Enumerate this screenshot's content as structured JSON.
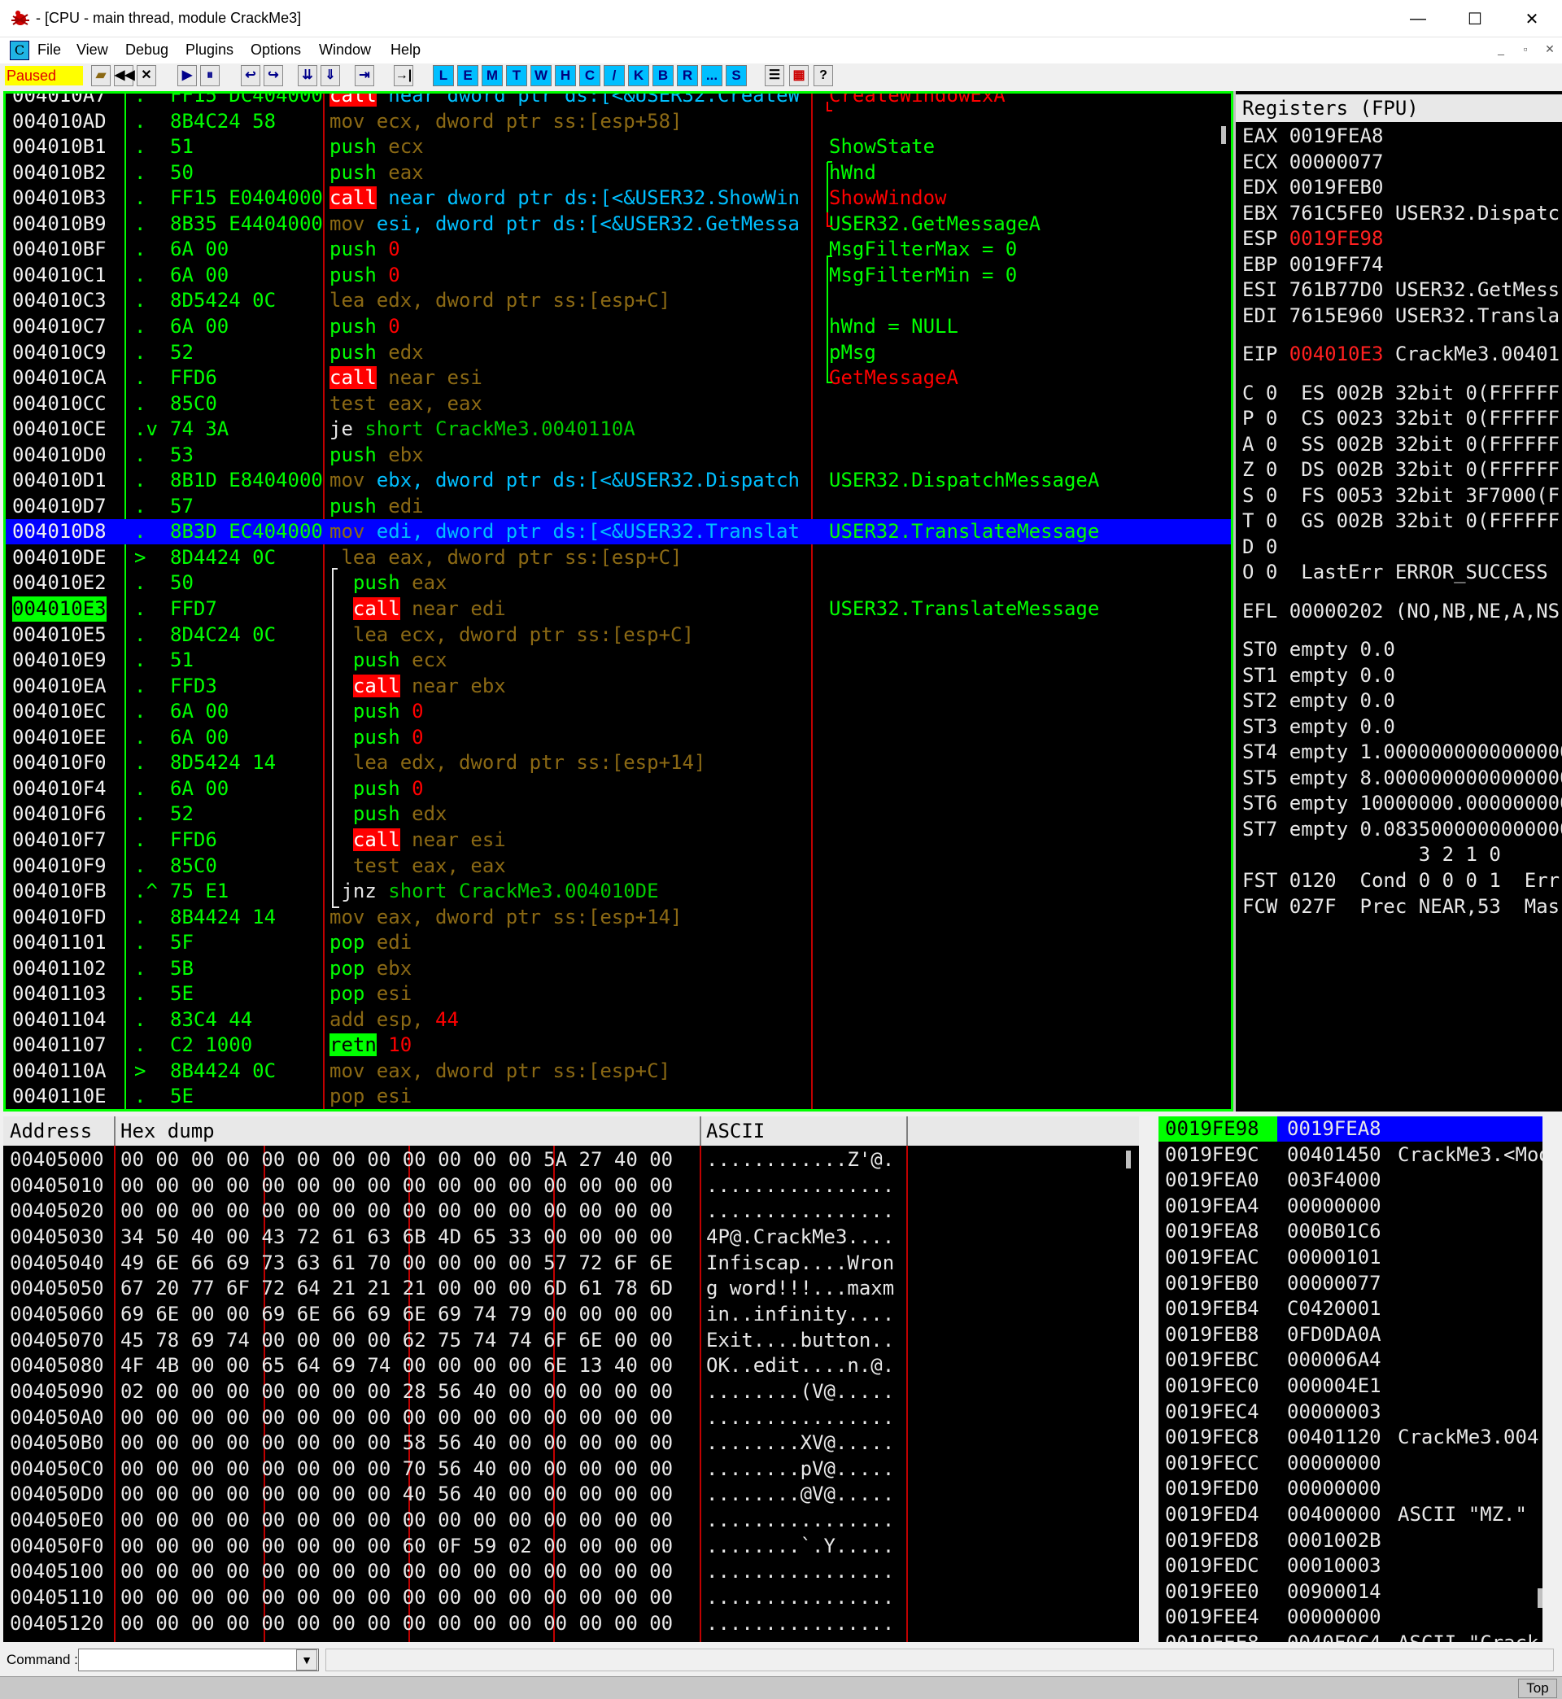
{
  "window": {
    "title": "- [CPU - main thread, module CrackMe3]",
    "minimize": "—",
    "maximize": "☐",
    "close": "✕"
  },
  "menu": {
    "cpu_icon": "C",
    "items": [
      "File",
      "View",
      "Debug",
      "Plugins",
      "Options",
      "Window",
      "Help"
    ],
    "mdi": [
      "_",
      "▫",
      "✕"
    ]
  },
  "toolbar": {
    "status": "Paused",
    "buttons": [
      "▶",
      "⏸",
      "↩",
      "↪",
      "⇊",
      "⇓",
      "⇥",
      "→|"
    ],
    "letters": [
      "L",
      "E",
      "M",
      "T",
      "W",
      "H",
      "C",
      "/",
      "K",
      "B",
      "R",
      "...",
      "S"
    ],
    "tail": [
      "☰",
      "▦",
      "?"
    ]
  },
  "disasm": {
    "rows": [
      {
        "addr": "004010A7",
        "mark": ".",
        "hex": "FF15 DC404000",
        "parts": [
          [
            "call",
            "call"
          ],
          [
            " near dword ptr ds:[<&USER32.CreateW",
            "cyan"
          ]
        ],
        "comment": "CreateWindowExA",
        "ccls": "red"
      },
      {
        "addr": "004010AD",
        "mark": ".",
        "hex": "8B4C24 58",
        "parts": [
          [
            "mov ecx, dword ptr ss:[esp+58]",
            "dim"
          ]
        ],
        "comment": ""
      },
      {
        "addr": "004010B1",
        "mark": ".",
        "hex": "51",
        "parts": [
          [
            "push ",
            "push"
          ],
          [
            "ecx",
            "dim"
          ]
        ],
        "comment": "ShowState"
      },
      {
        "addr": "004010B2",
        "mark": ".",
        "hex": "50",
        "parts": [
          [
            "push ",
            "push"
          ],
          [
            "eax",
            "dim"
          ]
        ],
        "comment": "hWnd"
      },
      {
        "addr": "004010B3",
        "mark": ".",
        "hex": "FF15 E0404000",
        "parts": [
          [
            "call",
            "call"
          ],
          [
            " near dword ptr ds:[<&USER32.ShowWin",
            "cyan"
          ]
        ],
        "comment": "ShowWindow",
        "ccls": "red"
      },
      {
        "addr": "004010B9",
        "mark": ".",
        "hex": "8B35 E4404000",
        "parts": [
          [
            "mov ",
            "dim"
          ],
          [
            "esi, dword ptr ds:[<&USER32.GetMessa",
            "cyan"
          ]
        ],
        "comment": "USER32.GetMessageA"
      },
      {
        "addr": "004010BF",
        "mark": ".",
        "hex": "6A 00",
        "parts": [
          [
            "push ",
            "push"
          ],
          [
            "0",
            "red"
          ]
        ],
        "comment": "MsgFilterMax = 0"
      },
      {
        "addr": "004010C1",
        "mark": ".",
        "hex": "6A 00",
        "parts": [
          [
            "push ",
            "push"
          ],
          [
            "0",
            "red"
          ]
        ],
        "comment": "MsgFilterMin = 0"
      },
      {
        "addr": "004010C3",
        "mark": ".",
        "hex": "8D5424 0C",
        "parts": [
          [
            "lea edx, dword ptr ss:[esp+C]",
            "dim"
          ]
        ],
        "comment": ""
      },
      {
        "addr": "004010C7",
        "mark": ".",
        "hex": "6A 00",
        "parts": [
          [
            "push ",
            "push"
          ],
          [
            "0",
            "red"
          ]
        ],
        "comment": "hWnd = NULL"
      },
      {
        "addr": "004010C9",
        "mark": ".",
        "hex": "52",
        "parts": [
          [
            "push ",
            "push"
          ],
          [
            "edx",
            "dim"
          ]
        ],
        "comment": "pMsg"
      },
      {
        "addr": "004010CA",
        "mark": ".",
        "hex": "FFD6",
        "parts": [
          [
            "call",
            "call"
          ],
          [
            " near esi",
            "dim"
          ]
        ],
        "comment": "GetMessageA",
        "ccls": "red"
      },
      {
        "addr": "004010CC",
        "mark": ".",
        "hex": "85C0",
        "parts": [
          [
            "test eax, eax",
            "dim"
          ]
        ],
        "comment": ""
      },
      {
        "addr": "004010CE",
        "mark": ".v",
        "hex": "74 3A",
        "parts": [
          [
            "je ",
            "white"
          ],
          [
            "short CrackMe3.0040110A",
            "green"
          ]
        ],
        "comment": ""
      },
      {
        "addr": "004010D0",
        "mark": ".",
        "hex": "53",
        "parts": [
          [
            "push ",
            "push"
          ],
          [
            "ebx",
            "dim"
          ]
        ],
        "comment": ""
      },
      {
        "addr": "004010D1",
        "mark": ".",
        "hex": "8B1D E8404000",
        "parts": [
          [
            "mov ",
            "dim"
          ],
          [
            "ebx, dword ptr ds:[<&USER32.Dispatch",
            "cyan"
          ]
        ],
        "comment": "USER32.DispatchMessageA"
      },
      {
        "addr": "004010D7",
        "mark": ".",
        "hex": "57",
        "parts": [
          [
            "push ",
            "push"
          ],
          [
            "edi",
            "dim"
          ]
        ],
        "comment": ""
      },
      {
        "addr": "004010D8",
        "mark": ".",
        "hex": "8B3D EC404000",
        "parts": [
          [
            "mov ",
            "dim"
          ],
          [
            "edi, dword ptr ds:[<&USER32.Translat",
            "cyan"
          ]
        ],
        "comment": "USER32.TranslateMessage",
        "sel": true
      },
      {
        "addr": "004010DE",
        "mark": ">",
        "hex": "8D4424 0C",
        "parts": [
          [
            " lea eax, dword ptr ss:[esp+C]",
            "dim"
          ]
        ],
        "comment": ""
      },
      {
        "addr": "004010E2",
        "mark": ".",
        "hex": "50",
        "parts": [
          [
            "  push ",
            "push"
          ],
          [
            "eax",
            "dim"
          ]
        ],
        "comment": ""
      },
      {
        "addr": "004010E3",
        "mark": ".",
        "hex": "FFD7",
        "parts": [
          [
            "  ",
            ""
          ],
          [
            "call",
            "call"
          ],
          [
            " near edi",
            "dim"
          ]
        ],
        "comment": "USER32.TranslateMessage",
        "eip": true
      },
      {
        "addr": "004010E5",
        "mark": ".",
        "hex": "8D4C24 0C",
        "parts": [
          [
            "  lea ecx, dword ptr ss:[esp+C]",
            "dim"
          ]
        ],
        "comment": ""
      },
      {
        "addr": "004010E9",
        "mark": ".",
        "hex": "51",
        "parts": [
          [
            "  push ",
            "push"
          ],
          [
            "ecx",
            "dim"
          ]
        ],
        "comment": ""
      },
      {
        "addr": "004010EA",
        "mark": ".",
        "hex": "FFD3",
        "parts": [
          [
            "  ",
            ""
          ],
          [
            "call",
            "call"
          ],
          [
            " near ebx",
            "dim"
          ]
        ],
        "comment": ""
      },
      {
        "addr": "004010EC",
        "mark": ".",
        "hex": "6A 00",
        "parts": [
          [
            "  push ",
            "push"
          ],
          [
            "0",
            "red"
          ]
        ],
        "comment": ""
      },
      {
        "addr": "004010EE",
        "mark": ".",
        "hex": "6A 00",
        "parts": [
          [
            "  push ",
            "push"
          ],
          [
            "0",
            "red"
          ]
        ],
        "comment": ""
      },
      {
        "addr": "004010F0",
        "mark": ".",
        "hex": "8D5424 14",
        "parts": [
          [
            "  lea edx, dword ptr ss:[esp+14]",
            "dim"
          ]
        ],
        "comment": ""
      },
      {
        "addr": "004010F4",
        "mark": ".",
        "hex": "6A 00",
        "parts": [
          [
            "  push ",
            "push"
          ],
          [
            "0",
            "red"
          ]
        ],
        "comment": ""
      },
      {
        "addr": "004010F6",
        "mark": ".",
        "hex": "52",
        "parts": [
          [
            "  push ",
            "push"
          ],
          [
            "edx",
            "dim"
          ]
        ],
        "comment": ""
      },
      {
        "addr": "004010F7",
        "mark": ".",
        "hex": "FFD6",
        "parts": [
          [
            "  ",
            ""
          ],
          [
            "call",
            "call"
          ],
          [
            " near esi",
            "dim"
          ]
        ],
        "comment": ""
      },
      {
        "addr": "004010F9",
        "mark": ".",
        "hex": "85C0",
        "parts": [
          [
            "  test eax, eax",
            "dim"
          ]
        ],
        "comment": ""
      },
      {
        "addr": "004010FB",
        "mark": ".^",
        "hex": "75 E1",
        "parts": [
          [
            " jnz ",
            "white"
          ],
          [
            "short CrackMe3.004010DE",
            "green"
          ]
        ],
        "comment": ""
      },
      {
        "addr": "004010FD",
        "mark": ".",
        "hex": "8B4424 14",
        "parts": [
          [
            "mov eax, dword ptr ss:[esp+14]",
            "dim"
          ]
        ],
        "comment": ""
      },
      {
        "addr": "00401101",
        "mark": ".",
        "hex": "5F",
        "parts": [
          [
            "pop ",
            "push"
          ],
          [
            "edi",
            "dim"
          ]
        ],
        "comment": ""
      },
      {
        "addr": "00401102",
        "mark": ".",
        "hex": "5B",
        "parts": [
          [
            "pop ",
            "push"
          ],
          [
            "ebx",
            "dim"
          ]
        ],
        "comment": ""
      },
      {
        "addr": "00401103",
        "mark": ".",
        "hex": "5E",
        "parts": [
          [
            "pop ",
            "push"
          ],
          [
            "esi",
            "dim"
          ]
        ],
        "comment": ""
      },
      {
        "addr": "00401104",
        "mark": ".",
        "hex": "83C4 44",
        "parts": [
          [
            "add esp, ",
            "dim"
          ],
          [
            "44",
            "red"
          ]
        ],
        "comment": ""
      },
      {
        "addr": "00401107",
        "mark": ".",
        "hex": "C2 1000",
        "parts": [
          [
            "retn",
            "retn"
          ],
          [
            " 10",
            "red"
          ]
        ],
        "comment": ""
      },
      {
        "addr": "0040110A",
        "mark": ">",
        "hex": "8B4424 0C",
        "parts": [
          [
            "mov eax, dword ptr ss:[esp+C]",
            "dim"
          ]
        ],
        "comment": ""
      },
      {
        "addr": "0040110E",
        "mark": ".",
        "hex": "5E",
        "parts": [
          [
            "pop esi",
            "dim"
          ]
        ],
        "comment": ""
      }
    ]
  },
  "registers": {
    "header": "Registers (FPU)",
    "rows": [
      {
        "t": "EAX 0019FEA8"
      },
      {
        "t": "ECX 00000077"
      },
      {
        "t": "EDX 0019FEB0"
      },
      {
        "t": "EBX 761C5FE0 USER32.Dispatc"
      },
      {
        "t": "ESP ",
        "v": "0019FE98",
        "vc": "red"
      },
      {
        "t": "EBP 0019FF74"
      },
      {
        "t": "ESI 761B77D0 USER32.GetMess"
      },
      {
        "t": "EDI 7615E960 USER32.Transla"
      },
      {
        "t": "EIP ",
        "v": "004010E3",
        "vc": "red",
        "s": " CrackMe3.00401"
      },
      {
        "t": "C 0  ES 002B 32bit 0(FFFFFF"
      },
      {
        "t": "P 0  CS 0023 32bit 0(FFFFFF"
      },
      {
        "t": "A 0  SS 002B 32bit 0(FFFFFF"
      },
      {
        "t": "Z 0  DS 002B 32bit 0(FFFFFF"
      },
      {
        "t": "S 0  FS 0053 32bit 3F7000(F"
      },
      {
        "t": "T 0  GS 002B 32bit 0(FFFFFF"
      },
      {
        "t": "D 0"
      },
      {
        "t": "O 0  LastErr ERROR_SUCCESS"
      },
      {
        "t": "EFL 00000202 (NO,NB,NE,A,NS"
      },
      {
        "t": "ST0 empty 0.0"
      },
      {
        "t": "ST1 empty 0.0"
      },
      {
        "t": "ST2 empty 0.0"
      },
      {
        "t": "ST3 empty 0.0"
      },
      {
        "t": "ST4 empty 1.00000000000000000"
      },
      {
        "t": "ST5 empty 8.00000000000000000"
      },
      {
        "t": "ST6 empty 10000000.000000000"
      },
      {
        "t": "ST7 empty 0.08350000000000000"
      },
      {
        "t": "               3 2 1 0"
      },
      {
        "t": "FST 0120  Cond 0 0 0 1  Err"
      },
      {
        "t": "FCW 027F  Prec NEAR,53  Mas"
      }
    ]
  },
  "dump": {
    "headers": [
      "Address",
      "Hex dump",
      "ASCII"
    ],
    "rows": [
      {
        "a": "00405000",
        "h": "00 00 00 00 00 00 00 00 00 00 00 00 5A 27 40 00",
        "s": "............Z'@."
      },
      {
        "a": "00405010",
        "h": "00 00 00 00 00 00 00 00 00 00 00 00 00 00 00 00",
        "s": "................"
      },
      {
        "a": "00405020",
        "h": "00 00 00 00 00 00 00 00 00 00 00 00 00 00 00 00",
        "s": "................"
      },
      {
        "a": "00405030",
        "h": "34 50 40 00 43 72 61 63 6B 4D 65 33 00 00 00 00",
        "s": "4P@.CrackMe3...."
      },
      {
        "a": "00405040",
        "h": "49 6E 66 69 73 63 61 70 00 00 00 00 57 72 6F 6E",
        "s": "Infiscap....Wron"
      },
      {
        "a": "00405050",
        "h": "67 20 77 6F 72 64 21 21 21 00 00 00 6D 61 78 6D",
        "s": "g word!!!...maxm"
      },
      {
        "a": "00405060",
        "h": "69 6E 00 00 69 6E 66 69 6E 69 74 79 00 00 00 00",
        "s": "in..infinity...."
      },
      {
        "a": "00405070",
        "h": "45 78 69 74 00 00 00 00 62 75 74 74 6F 6E 00 00",
        "s": "Exit....button.."
      },
      {
        "a": "00405080",
        "h": "4F 4B 00 00 65 64 69 74 00 00 00 00 6E 13 40 00",
        "s": "OK..edit....n.@."
      },
      {
        "a": "00405090",
        "h": "02 00 00 00 00 00 00 00 28 56 40 00 00 00 00 00",
        "s": "........(V@....."
      },
      {
        "a": "004050A0",
        "h": "00 00 00 00 00 00 00 00 00 00 00 00 00 00 00 00",
        "s": "................"
      },
      {
        "a": "004050B0",
        "h": "00 00 00 00 00 00 00 00 58 56 40 00 00 00 00 00",
        "s": "........XV@....."
      },
      {
        "a": "004050C0",
        "h": "00 00 00 00 00 00 00 00 70 56 40 00 00 00 00 00",
        "s": "........pV@....."
      },
      {
        "a": "004050D0",
        "h": "00 00 00 00 00 00 00 00 40 56 40 00 00 00 00 00",
        "s": "........@V@....."
      },
      {
        "a": "004050E0",
        "h": "00 00 00 00 00 00 00 00 00 00 00 00 00 00 00 00",
        "s": "................"
      },
      {
        "a": "004050F0",
        "h": "00 00 00 00 00 00 00 00 60 0F 59 02 00 00 00 00",
        "s": "........`.Y....."
      },
      {
        "a": "00405100",
        "h": "00 00 00 00 00 00 00 00 00 00 00 00 00 00 00 00",
        "s": "................"
      },
      {
        "a": "00405110",
        "h": "00 00 00 00 00 00 00 00 00 00 00 00 00 00 00 00",
        "s": "................"
      },
      {
        "a": "00405120",
        "h": "00 00 00 00 00 00 00 00 00 00 00 00 00 00 00 00",
        "s": "................"
      }
    ]
  },
  "stack": {
    "rows": [
      {
        "a": "0019FE98",
        "v": "0019FEA8",
        "c": "",
        "top": true
      },
      {
        "a": "0019FE9C",
        "v": "00401450",
        "c": "CrackMe3.<Mod"
      },
      {
        "a": "0019FEA0",
        "v": "003F4000",
        "c": ""
      },
      {
        "a": "0019FEA4",
        "v": "00000000",
        "c": ""
      },
      {
        "a": "0019FEA8",
        "v": "000B01C6",
        "c": ""
      },
      {
        "a": "0019FEAC",
        "v": "00000101",
        "c": ""
      },
      {
        "a": "0019FEB0",
        "v": "00000077",
        "c": ""
      },
      {
        "a": "0019FEB4",
        "v": "C0420001",
        "c": ""
      },
      {
        "a": "0019FEB8",
        "v": "0FD0DA0A",
        "c": ""
      },
      {
        "a": "0019FEBC",
        "v": "000006A4",
        "c": ""
      },
      {
        "a": "0019FEC0",
        "v": "000004E1",
        "c": ""
      },
      {
        "a": "0019FEC4",
        "v": "00000003",
        "c": ""
      },
      {
        "a": "0019FEC8",
        "v": "00401120",
        "c": "CrackMe3.004"
      },
      {
        "a": "0019FECC",
        "v": "00000000",
        "c": ""
      },
      {
        "a": "0019FED0",
        "v": "00000000",
        "c": ""
      },
      {
        "a": "0019FED4",
        "v": "00400000",
        "c": "ASCII \"MZ.\""
      },
      {
        "a": "0019FED8",
        "v": "0001002B",
        "c": ""
      },
      {
        "a": "0019FEDC",
        "v": "00010003",
        "c": ""
      },
      {
        "a": "0019FEE0",
        "v": "00900014",
        "c": ""
      },
      {
        "a": "0019FEE4",
        "v": "00000000",
        "c": ""
      },
      {
        "a": "0019FEE8",
        "v": "0040F0C4",
        "c": "ASCII \"Crack"
      }
    ]
  },
  "command": {
    "label": "Command :",
    "value": ""
  },
  "status": {
    "top_label": "Top"
  }
}
